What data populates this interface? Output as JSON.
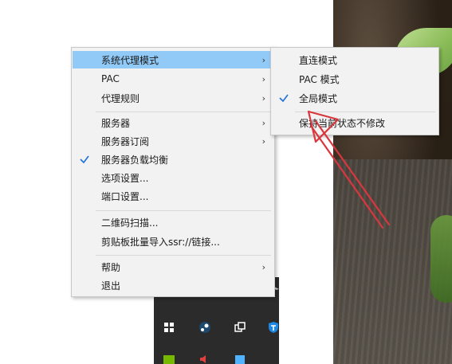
{
  "colors": {
    "menu_bg": "#f2f2f2",
    "highlight": "#91c9f7",
    "check": "#1e6fd9",
    "arrow_annotation": "#d9363e",
    "tray_bg": "#2b2b2b"
  },
  "menu": {
    "items": [
      {
        "label": "系统代理模式",
        "has_submenu": true,
        "highlighted": true
      },
      {
        "label": "PAC",
        "has_submenu": true
      },
      {
        "label": "代理规则",
        "has_submenu": true
      },
      {
        "label": "服务器",
        "has_submenu": true
      },
      {
        "label": "服务器订阅",
        "has_submenu": true
      },
      {
        "label": "服务器负载均衡",
        "checked": true
      },
      {
        "label": "选项设置..."
      },
      {
        "label": "端口设置..."
      },
      {
        "label": "二维码扫描..."
      },
      {
        "label": "剪贴板批量导入ssr://链接..."
      },
      {
        "label": "帮助",
        "has_submenu": true
      },
      {
        "label": "退出"
      }
    ],
    "arrow_glyph": "›"
  },
  "submenu": {
    "items": [
      {
        "label": "直连模式"
      },
      {
        "label": "PAC 模式"
      },
      {
        "label": "全局模式",
        "checked": true
      },
      {
        "label": "保持当前状态不修改"
      }
    ]
  },
  "tray": {
    "icons": [
      "arrow-icon",
      "windows-flag-icon",
      "steam-icon",
      "copy-icon",
      "shield-icon",
      "nvidia-icon",
      "speaker-icon",
      "app-icon"
    ]
  }
}
